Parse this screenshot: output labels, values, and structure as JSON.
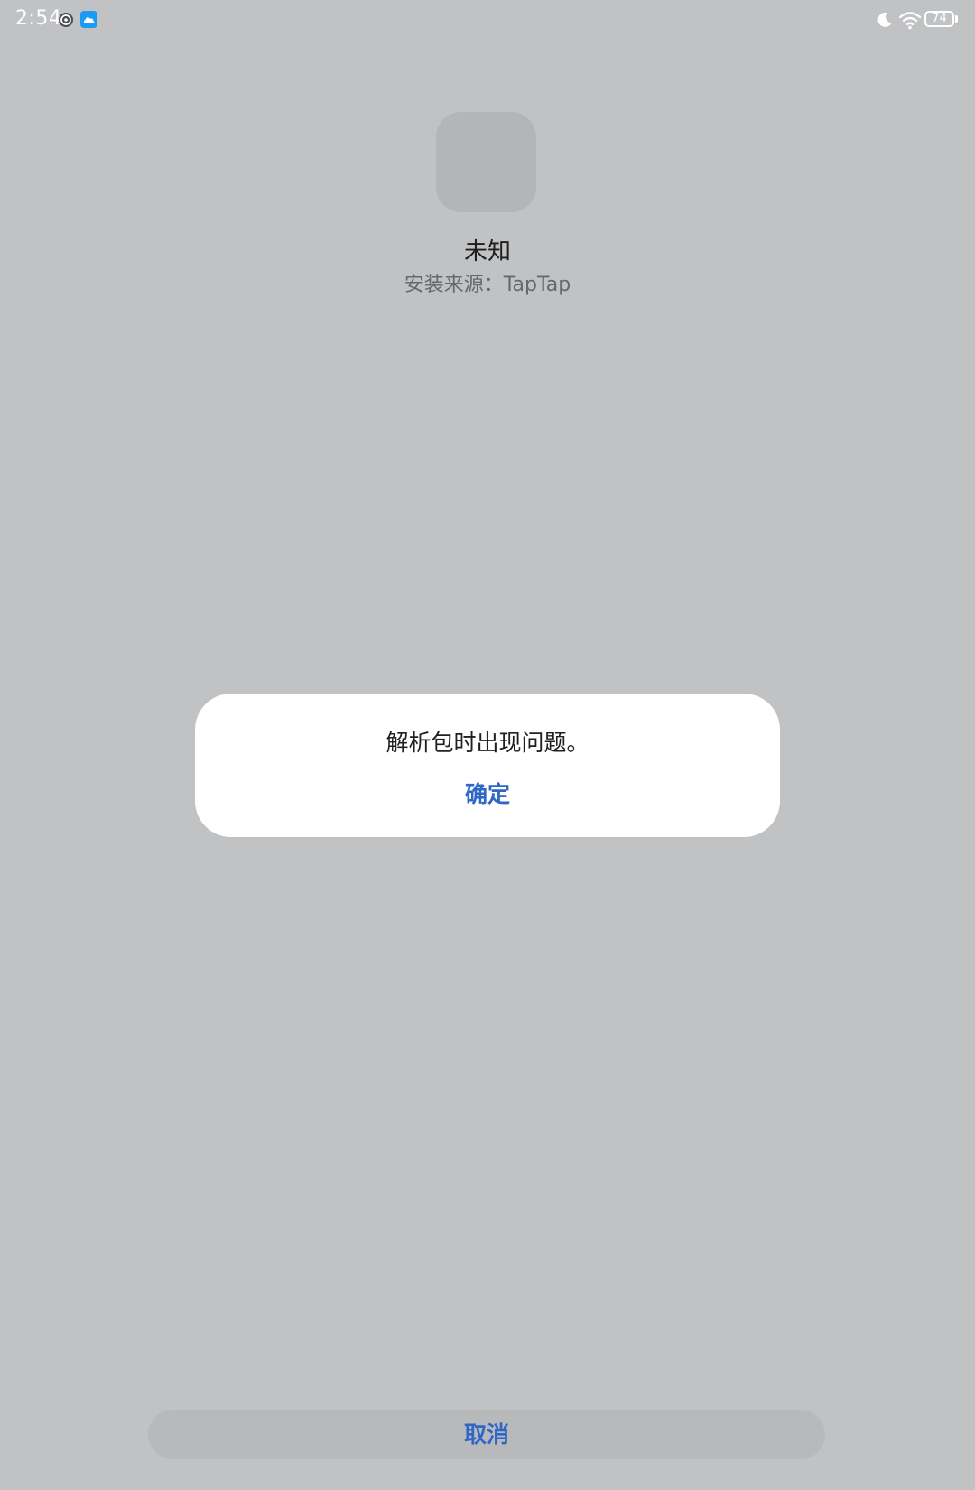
{
  "status_bar": {
    "time": "2:54",
    "battery": "74",
    "icons": [
      "settings-icon",
      "cloud-icon",
      "moon-icon",
      "wifi-icon",
      "battery-icon"
    ]
  },
  "app": {
    "name": "未知",
    "install_source": "安装来源：TapTap"
  },
  "dialog": {
    "message": "解析包时出现问题。",
    "confirm_label": "确定"
  },
  "footer": {
    "cancel_label": "取消"
  },
  "colors": {
    "background": "#c1c2c4",
    "accent": "#2f67c6",
    "dialog": "#ffffff"
  }
}
